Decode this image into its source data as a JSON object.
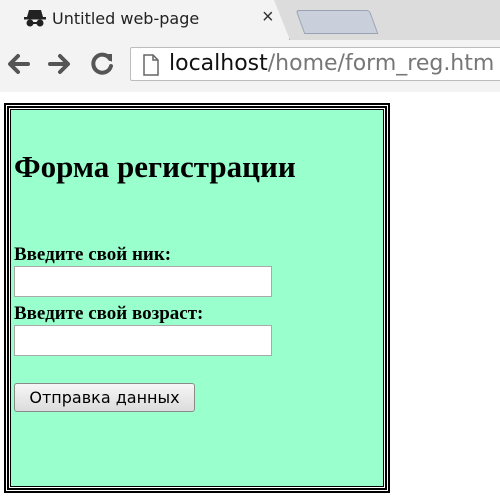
{
  "browser": {
    "tab_title": "Untitled web-page",
    "close_glyph": "×",
    "url_host": "localhost",
    "url_path": "/home/form_reg.htm",
    "tab_icon": "incognito-icon"
  },
  "form": {
    "title": "Форма регистрации",
    "nickname_label": "Введите свой ник:",
    "nickname_value": "",
    "age_label": "Введите свой возраст:",
    "age_value": "",
    "submit_label": "Отправка данных",
    "background_color": "#99ffcc"
  }
}
